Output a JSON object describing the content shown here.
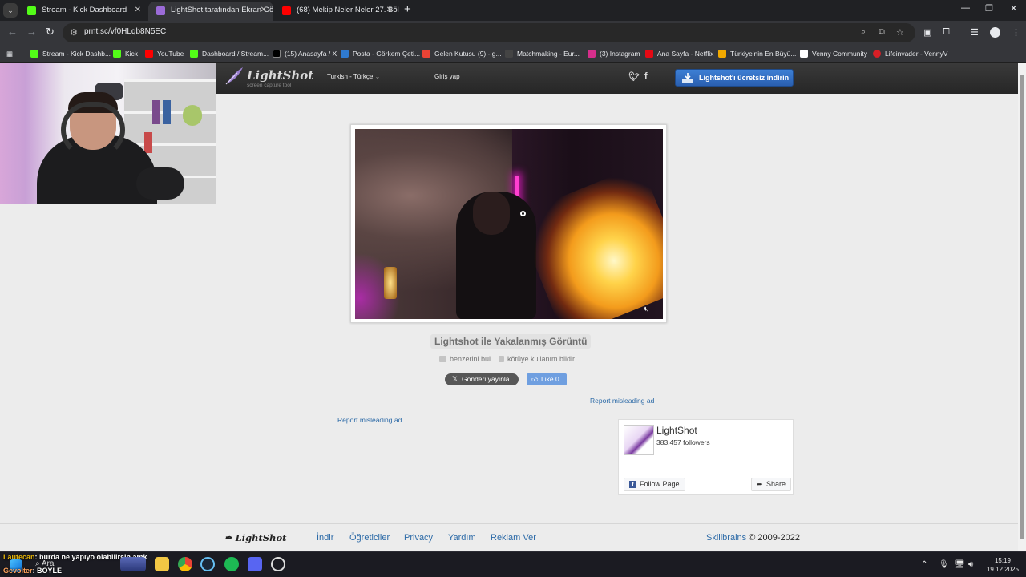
{
  "browser": {
    "tabs": [
      {
        "title": "Stream - Kick Dashboard",
        "favicon_color": "#53fc18",
        "active": false
      },
      {
        "title": "LightShot tarafından Ekran Gör",
        "favicon_color": "#9b6bd8",
        "active": true
      },
      {
        "title": "(68) Mekip Neler Neler 27. Bölü",
        "favicon_color": "#ff0000",
        "active": false
      }
    ],
    "url": "prnt.sc/vf0HLqb8N5EC",
    "bookmarks": [
      {
        "label": "Stream - Kick Dashb...",
        "favicon_color": "#53fc18"
      },
      {
        "label": "Kick",
        "favicon_color": "#53fc18"
      },
      {
        "label": "YouTube",
        "favicon_color": "#ff0000"
      },
      {
        "label": "Dashboard / Stream...",
        "favicon_color": "#53fc18"
      },
      {
        "label": "(15) Anasayfa / X",
        "favicon_color": "#000000"
      },
      {
        "label": "Posta - Görkem Çeti...",
        "favicon_color": "#2f7ad0"
      },
      {
        "label": "Gelen Kutusu (9) - g...",
        "favicon_color": "#ea4335"
      },
      {
        "label": "Matchmaking - Eur...",
        "favicon_color": "#444444"
      },
      {
        "label": "(3) Instagram",
        "favicon_color": "#d62e8c"
      },
      {
        "label": "Ana Sayfa - Netflix",
        "favicon_color": "#e50914"
      },
      {
        "label": "Türkiye'nin En Büyü...",
        "favicon_color": "#f2a900"
      },
      {
        "label": "Venny Community",
        "favicon_color": "#ffffff"
      },
      {
        "label": "Lifeinvader - VennyV",
        "favicon_color": "#d81f26"
      }
    ]
  },
  "site": {
    "logo_name": "LightShot",
    "logo_tagline": "screen capture tool",
    "language": "Turkish - Türkçe",
    "login": "Giriş yap",
    "download_button": "Lightshot'ı ücretsiz indirin",
    "caption": "Lightshot ile Yakalanmış Görüntü",
    "find_similar": "benzerini bul",
    "report_abuse": "kötüye kullanım bildir",
    "tweet_button": "Gönderi yayınla",
    "like_button": "Like 0",
    "report_misleading": "Report misleading ad",
    "facebook_widget": {
      "page_name": "LightShot",
      "followers": "383,457 followers",
      "follow_button": "Follow Page",
      "share_button": "Share"
    },
    "footer": {
      "logo": "LightShot",
      "links": [
        "İndir",
        "Öğreticiler",
        "Privacy",
        "Yardım",
        "Reklam Ver"
      ],
      "company": "Skillbrains",
      "copyright": "© 2009-2022"
    }
  },
  "stream_overlay": {
    "chat": [
      {
        "user": "Lautecan",
        "message": ": burda ne yapıyo olabilirsin amk"
      },
      {
        "user": "Gevolter",
        "message": ": BÖYLE"
      }
    ],
    "search_placeholder": "Ara"
  },
  "taskbar": {
    "time": "15:19",
    "date": "19.12.2025"
  }
}
